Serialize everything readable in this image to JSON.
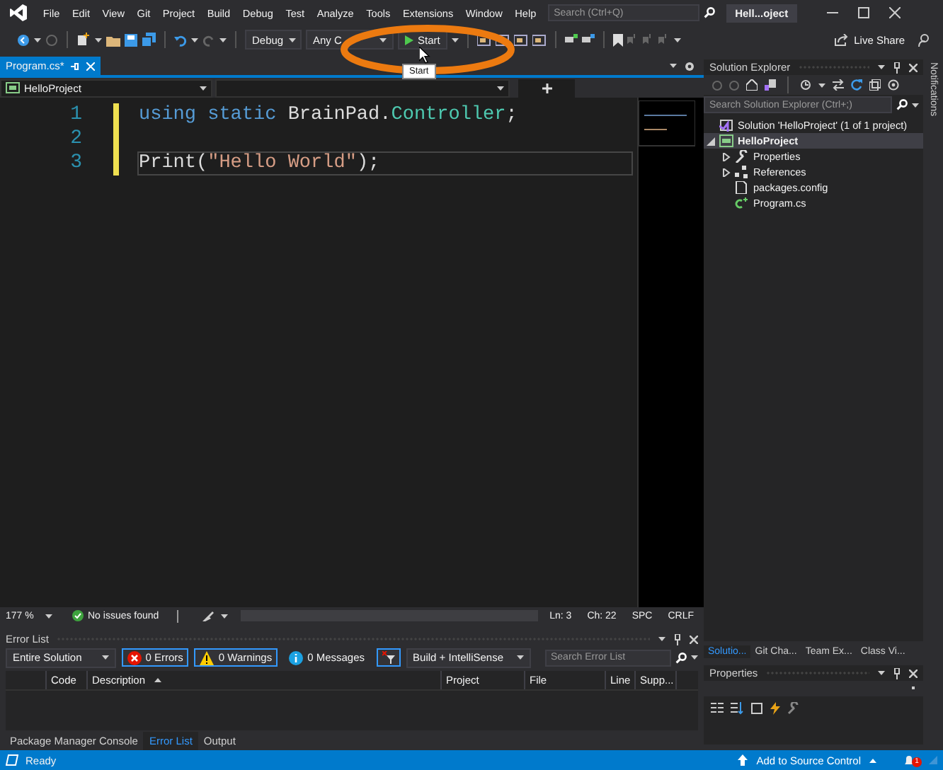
{
  "menu": [
    "File",
    "Edit",
    "View",
    "Git",
    "Project",
    "Build",
    "Debug",
    "Test",
    "Analyze",
    "Tools",
    "Extensions",
    "Window",
    "Help"
  ],
  "search": {
    "placeholder": "Search (Ctrl+Q)"
  },
  "window_title": "Hell...oject",
  "toolbar": {
    "configuration": "Debug",
    "platform": "Any C",
    "start_button": "Start",
    "live_share": "Live Share"
  },
  "tooltip": "Start",
  "document_tab": {
    "title": "Program.cs*",
    "selected": true
  },
  "navigation_bar": {
    "project": "HelloProject"
  },
  "editor": {
    "lines": [
      {
        "number": "1",
        "modified": true,
        "current": false,
        "tokens": [
          {
            "kind": "keyword",
            "text": "using static "
          },
          {
            "kind": "plain",
            "text": "BrainPad."
          },
          {
            "kind": "type",
            "text": "Controller"
          },
          {
            "kind": "plain",
            "text": ";"
          }
        ]
      },
      {
        "number": "2",
        "modified": true,
        "current": false
      },
      {
        "number": "3",
        "modified": true,
        "current": true,
        "tokens": [
          {
            "kind": "plain",
            "text": "Print("
          },
          {
            "kind": "string",
            "text": "\"Hello World\""
          },
          {
            "kind": "plain",
            "text": ");"
          }
        ]
      }
    ]
  },
  "editor_status": {
    "zoom": "177 %",
    "issues": "No issues found",
    "line": "Ln: 3",
    "char": "Ch: 22",
    "whitespace": "SPC",
    "line_ending": "CRLF"
  },
  "solution_explorer": {
    "title": "Solution Explorer",
    "search": {
      "placeholder": "Search Solution Explorer (Ctrl+;)"
    },
    "tree": [
      {
        "label": "Solution 'HelloProject' (1 of 1 project)",
        "kind": "solution",
        "children": [
          {
            "label": "HelloProject",
            "kind": "project",
            "expanded": true,
            "children": [
              {
                "label": "Properties",
                "kind": "properties",
                "expanded": false
              },
              {
                "label": "References",
                "kind": "references",
                "expanded": false
              },
              {
                "label": "packages.config",
                "kind": "config"
              },
              {
                "label": "Program.cs",
                "kind": "csharp"
              }
            ]
          }
        ]
      }
    ]
  },
  "side_tabs": [
    {
      "label": "Solutio...",
      "selected": true
    },
    {
      "label": "Git Cha...",
      "selected": false
    },
    {
      "label": "Team Ex...",
      "selected": false
    },
    {
      "label": "Class Vi...",
      "selected": false
    }
  ],
  "properties": {
    "title": "Properties"
  },
  "notifications_label": "Notifications",
  "error_list": {
    "title": "Error List",
    "scope": "Entire Solution",
    "filters": [
      {
        "label": "0 Errors",
        "kind": "error",
        "selected": true
      },
      {
        "label": "0 Warnings",
        "kind": "warning",
        "selected": true
      },
      {
        "label": "0 Messages",
        "kind": "message",
        "selected": false
      }
    ],
    "build_filter": "Build + IntelliSense",
    "search": {
      "placeholder": "Search Error List"
    },
    "columns": [
      "Code",
      "Description",
      "Project",
      "File",
      "Line",
      "Supp..."
    ]
  },
  "bottom_tabs": [
    {
      "label": "Package Manager Console",
      "selected": false
    },
    {
      "label": "Error List",
      "selected": true
    },
    {
      "label": "Output",
      "selected": false
    }
  ],
  "status_bar": {
    "text": "Ready",
    "source_control": "Add to Source Control",
    "notification_count": "1"
  }
}
